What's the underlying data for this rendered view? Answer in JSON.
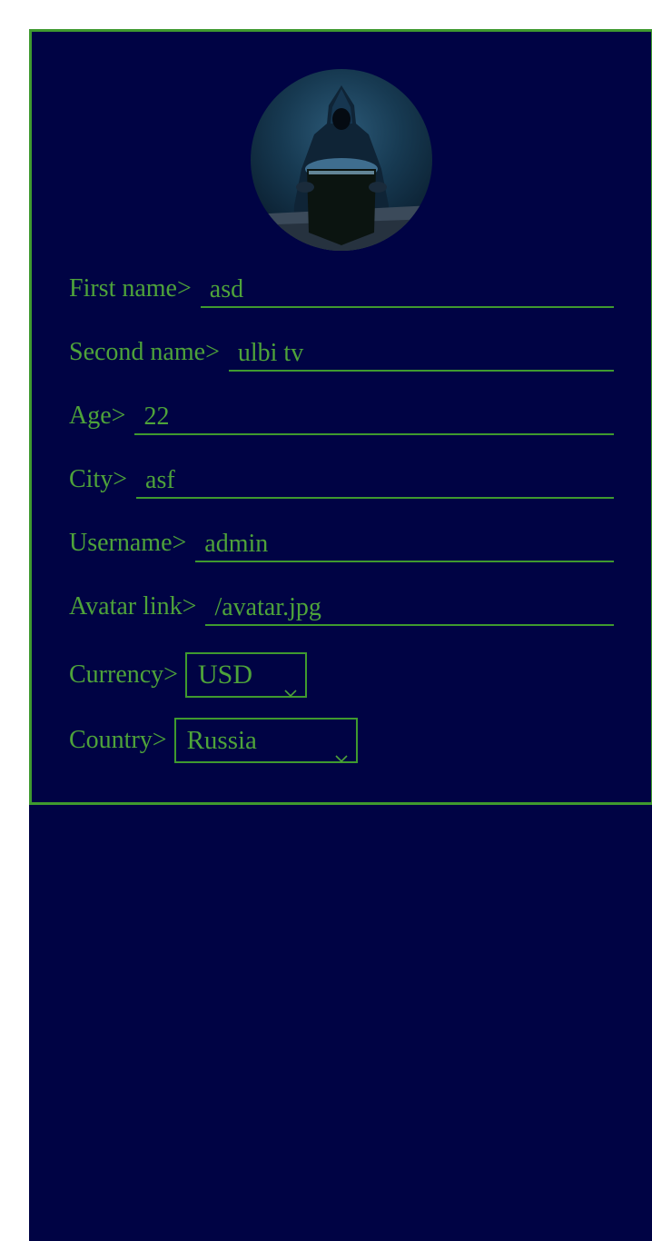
{
  "profile": {
    "avatar_alt": "avatar",
    "fields": [
      {
        "label": "First name>",
        "value": "asd"
      },
      {
        "label": "Second name>",
        "value": "ulbi tv"
      },
      {
        "label": "Age>",
        "value": "22"
      },
      {
        "label": "City>",
        "value": "asf"
      },
      {
        "label": "Username>",
        "value": "admin"
      },
      {
        "label": "Avatar link>",
        "value": "/avatar.jpg"
      }
    ],
    "currency": {
      "label": "Currency>",
      "selected": "USD"
    },
    "country": {
      "label": "Country>",
      "selected": "Russia"
    }
  },
  "colors": {
    "background": "#000344",
    "accent": "#3f9a2f",
    "text": "#4ea33a"
  },
  "icons": {
    "select_arrow": "chevron-down-icon"
  }
}
